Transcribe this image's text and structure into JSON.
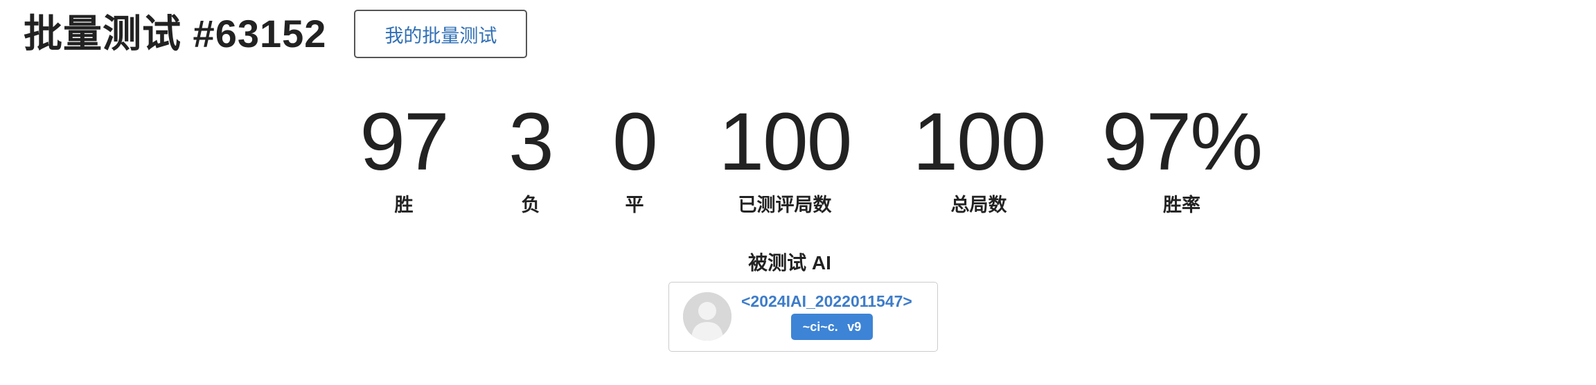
{
  "header": {
    "title": "批量测试 #63152",
    "my_batch_button": "我的批量测试"
  },
  "stats": [
    {
      "value": "97",
      "label": "胜"
    },
    {
      "value": "3",
      "label": "负"
    },
    {
      "value": "0",
      "label": "平"
    },
    {
      "value": "100",
      "label": "已测评局数"
    },
    {
      "value": "100",
      "label": "总局数"
    },
    {
      "value": "97%",
      "label": "胜率"
    }
  ],
  "tested_ai": {
    "section_title": "被测试 AI",
    "name": "<2024IAI_2022011547>",
    "badge_name": "~ci~c.",
    "badge_version": "v9",
    "avatar_icon": "default-user-avatar-icon"
  },
  "colors": {
    "link_blue": "#3d7cc9",
    "badge_blue": "#3d84d6",
    "text_dark": "#222222"
  }
}
